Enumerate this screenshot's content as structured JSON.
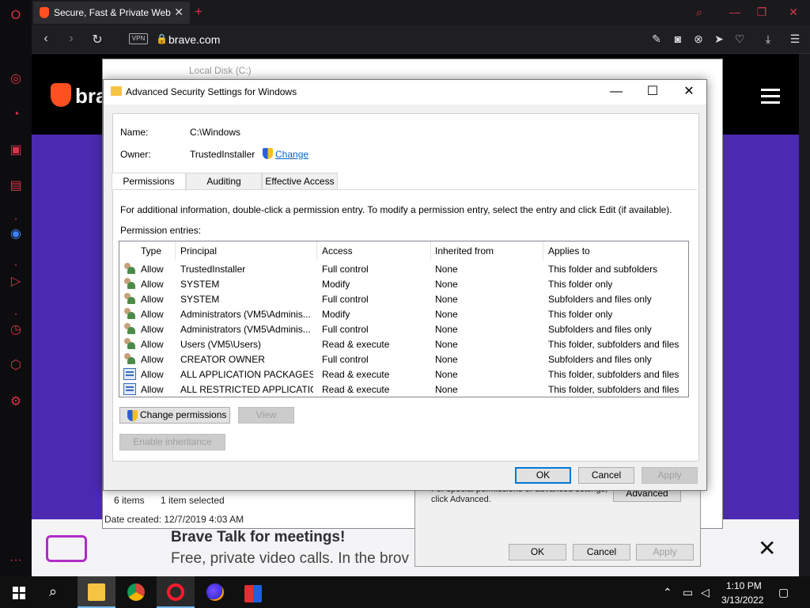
{
  "browser": {
    "tab_title": "Secure, Fast & Private Web",
    "url": "brave.com",
    "vpn_label": "VPN"
  },
  "page": {
    "logo_text": "bra",
    "banner_title": "Brave Talk for meetings!",
    "banner_subtitle": "Free, private video calls. In the brov"
  },
  "explorer": {
    "title": "Local Disk (C:)",
    "status_items": "6 items",
    "status_selected": "1 item selected",
    "date_created": "Date created: 12/7/2019 4:03 AM"
  },
  "properties": {
    "text": "For special permissions or advanced settings, click Advanced.",
    "advanced_label": "Advanced",
    "ok_label": "OK",
    "cancel_label": "Cancel",
    "apply_label": "Apply"
  },
  "dialog": {
    "title": "Advanced Security Settings for Windows",
    "name_label": "Name:",
    "name_value": "C:\\Windows",
    "owner_label": "Owner:",
    "owner_value": "TrustedInstaller",
    "change_link": "Change",
    "tabs": [
      "Permissions",
      "Auditing",
      "Effective Access"
    ],
    "info_text": "For additional information, double-click a permission entry. To modify a permission entry, select the entry and click Edit (if available).",
    "entries_label": "Permission entries:",
    "columns": [
      "Type",
      "Principal",
      "Access",
      "Inherited from",
      "Applies to"
    ],
    "rows": [
      {
        "icon": "users",
        "type": "Allow",
        "principal": "TrustedInstaller",
        "access": "Full control",
        "inherited": "None",
        "applies": "This folder and subfolders"
      },
      {
        "icon": "users",
        "type": "Allow",
        "principal": "SYSTEM",
        "access": "Modify",
        "inherited": "None",
        "applies": "This folder only"
      },
      {
        "icon": "users",
        "type": "Allow",
        "principal": "SYSTEM",
        "access": "Full control",
        "inherited": "None",
        "applies": "Subfolders and files only"
      },
      {
        "icon": "users",
        "type": "Allow",
        "principal": "Administrators (VM5\\Adminis...",
        "access": "Modify",
        "inherited": "None",
        "applies": "This folder only"
      },
      {
        "icon": "users",
        "type": "Allow",
        "principal": "Administrators (VM5\\Adminis...",
        "access": "Full control",
        "inherited": "None",
        "applies": "Subfolders and files only"
      },
      {
        "icon": "users",
        "type": "Allow",
        "principal": "Users (VM5\\Users)",
        "access": "Read & execute",
        "inherited": "None",
        "applies": "This folder, subfolders and files"
      },
      {
        "icon": "users",
        "type": "Allow",
        "principal": "CREATOR OWNER",
        "access": "Full control",
        "inherited": "None",
        "applies": "Subfolders and files only"
      },
      {
        "icon": "package",
        "type": "Allow",
        "principal": "ALL APPLICATION PACKAGES",
        "access": "Read & execute",
        "inherited": "None",
        "applies": "This folder, subfolders and files"
      },
      {
        "icon": "package",
        "type": "Allow",
        "principal": "ALL RESTRICTED APPLICATIO...",
        "access": "Read & execute",
        "inherited": "None",
        "applies": "This folder, subfolders and files"
      }
    ],
    "change_permissions_label": "Change permissions",
    "view_label": "View",
    "enable_inheritance_label": "Enable inheritance",
    "ok_label": "OK",
    "cancel_label": "Cancel",
    "apply_label": "Apply"
  },
  "taskbar": {
    "time": "1:10 PM",
    "date": "3/13/2022"
  },
  "colors": {
    "opera_red": "#d8344a",
    "brave_orange": "#ff5021",
    "page_purple": "#4b2ab0",
    "link_blue": "#0066cc",
    "focus_blue": "#0078d7"
  }
}
